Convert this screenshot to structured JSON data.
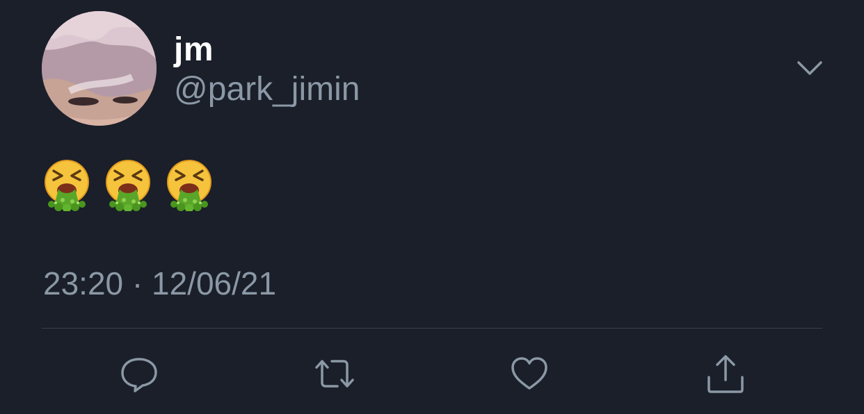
{
  "user": {
    "display_name": "jm",
    "handle": "@park_jimin"
  },
  "tweet": {
    "text": "🤮🤮🤮",
    "emoji_count": 3,
    "emoji_name": "face-vomiting",
    "timestamp": "23:20 · 12/06/21"
  },
  "icons": {
    "menu": "chevron-down-icon",
    "actions": [
      "reply-icon",
      "retweet-icon",
      "like-icon",
      "share-icon"
    ]
  },
  "colors": {
    "background": "#1a1f2a",
    "primary_text": "#ffffff",
    "secondary_text": "#8b98a5",
    "divider": "#38444d"
  }
}
